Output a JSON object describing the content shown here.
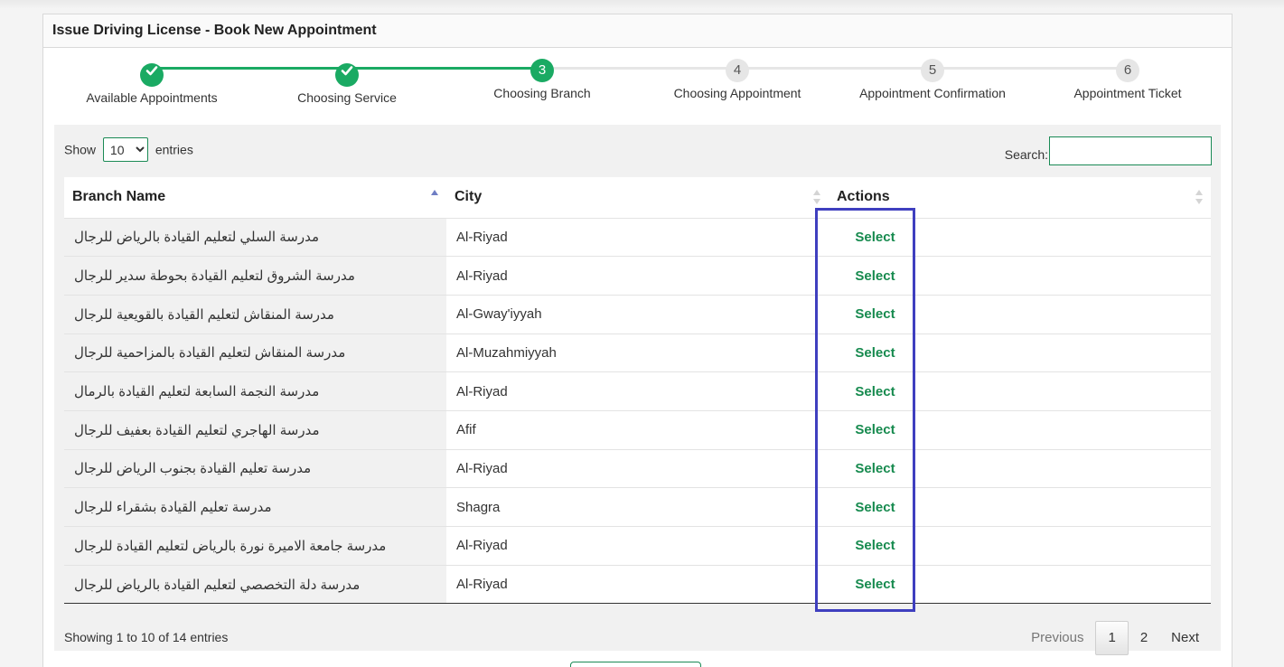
{
  "panel": {
    "title": "Issue Driving License - Book New Appointment"
  },
  "stepper": {
    "steps": [
      {
        "number": "1",
        "label": "Available Appointments",
        "state": "done"
      },
      {
        "number": "2",
        "label": "Choosing Service",
        "state": "done"
      },
      {
        "number": "3",
        "label": "Choosing Branch",
        "state": "active"
      },
      {
        "number": "4",
        "label": "Choosing Appointment",
        "state": "pending"
      },
      {
        "number": "5",
        "label": "Appointment Confirmation",
        "state": "pending"
      },
      {
        "number": "6",
        "label": "Appointment Ticket",
        "state": "pending"
      }
    ],
    "colors": {
      "done": "#1aaa63",
      "pending": "#e6e6e6"
    }
  },
  "table_controls": {
    "show_label": "Show",
    "entries_label": "entries",
    "page_length": "10",
    "search_label": "Search:",
    "search_value": ""
  },
  "table": {
    "headers": {
      "branch_name": "Branch Name",
      "city": "City",
      "actions": "Actions"
    },
    "action_label": "Select",
    "rows": [
      {
        "name": "مدرسة السلي لتعليم القيادة بالرياض للرجال",
        "city": "Al-Riyad"
      },
      {
        "name": "مدرسة الشروق لتعليم القيادة بحوطة سدير للرجال",
        "city": "Al-Riyad"
      },
      {
        "name": "مدرسة المنقاش لتعليم القيادة بالقويعية للرجال",
        "city": "Al-Gway'iyyah"
      },
      {
        "name": "مدرسة المنقاش لتعليم القيادة بالمزاحمية للرجال",
        "city": "Al-Muzahmiyyah"
      },
      {
        "name": "مدرسة النجمة السابعة لتعليم القيادة بالرمال",
        "city": "Al-Riyad"
      },
      {
        "name": "مدرسة الهاجري لتعليم القيادة بعفيف للرجال",
        "city": "Afif"
      },
      {
        "name": "مدرسة تعليم القيادة بجنوب الرياض للرجال",
        "city": "Al-Riyad"
      },
      {
        "name": "مدرسة تعليم القيادة بشقراء للرجال",
        "city": "Shagra"
      },
      {
        "name": "مدرسة جامعة الاميرة نورة بالرياض لتعليم القيادة للرجال",
        "city": "Al-Riyad"
      },
      {
        "name": "مدرسة دلة التخصصي لتعليم القيادة بالرياض للرجال",
        "city": "Al-Riyad"
      }
    ]
  },
  "footer": {
    "info": "Showing 1 to 10 of 14 entries",
    "previous": "Previous",
    "pages": [
      "1",
      "2"
    ],
    "current_page": "1",
    "next": "Next"
  },
  "colors": {
    "accent": "#1aaa63",
    "link": "#168a4e",
    "highlight": "#3f3fbf"
  }
}
